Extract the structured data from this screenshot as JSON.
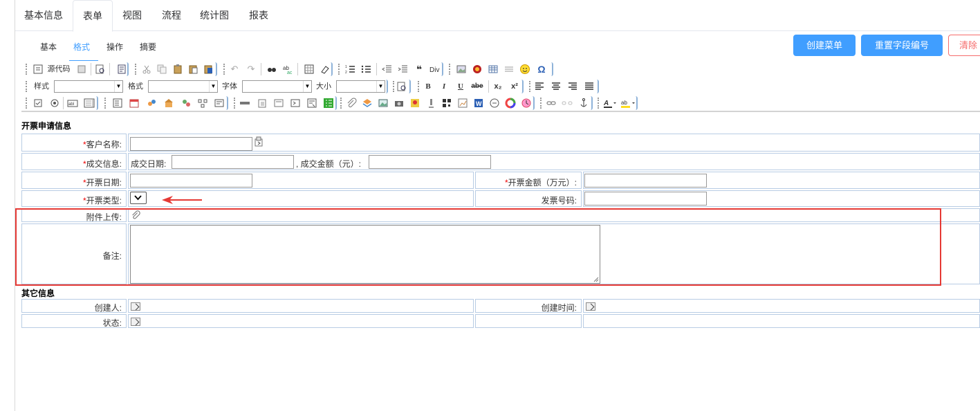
{
  "top_tabs": [
    {
      "label": "基本信息"
    },
    {
      "label": "表单"
    },
    {
      "label": "视图"
    },
    {
      "label": "流程"
    },
    {
      "label": "统计图"
    },
    {
      "label": "报表"
    }
  ],
  "sub_tabs": [
    {
      "label": "基本"
    },
    {
      "label": "格式"
    },
    {
      "label": "操作"
    },
    {
      "label": "摘要"
    }
  ],
  "buttons": {
    "create_menu": "创建菜单",
    "reset_field_no": "重置字段编号",
    "clear": "清除"
  },
  "toolbar": {
    "source_code": "源代码",
    "style_label": "样式",
    "format_label": "格式",
    "font_label": "字体",
    "size_label": "大小",
    "bold": "B",
    "italic": "I",
    "underline": "U",
    "strike": "abe",
    "subscript": "x₂",
    "superscript": "x²",
    "quote": "❝",
    "omega": "Ω"
  },
  "form": {
    "section1_title": "开票申请信息",
    "customer_name_label": "客户名称:",
    "deal_info_label": "成交信息:",
    "deal_date_label": "成交日期:",
    "deal_amount_label": "成交金额（元）:",
    "invoice_date_label": "开票日期:",
    "invoice_amount_label": "开票金额（万元）:",
    "invoice_type_label": "开票类型:",
    "invoice_no_label": "发票号码:",
    "attachment_label": "附件上传:",
    "remark_label": "备注:",
    "section2_title": "其它信息",
    "creator_label": "创建人:",
    "create_time_label": "创建时间:",
    "status_label": "状态:",
    "required_mark": "*"
  },
  "colors": {
    "accent": "#409eff",
    "danger": "#f56c6c",
    "highlight": "#e53935",
    "cell_border": "#b8cce4"
  }
}
